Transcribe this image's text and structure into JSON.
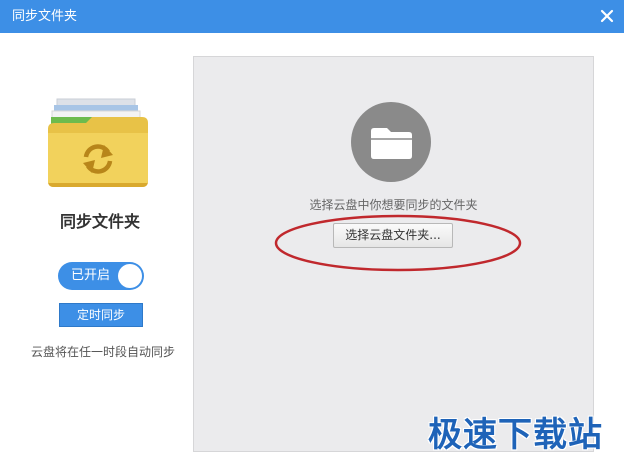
{
  "window": {
    "title": "同步文件夹",
    "accent_color": "#3d8fe6",
    "close_icon": "close-icon"
  },
  "sidebar": {
    "folder_icon": "sync-folder-icon",
    "heading": "同步文件夹",
    "toggle_label": "已开启",
    "toggle_on": true,
    "timer_button": "定时同步",
    "note": "云盘将在任一时段自动同步"
  },
  "main": {
    "folder_icon": "folder-icon",
    "prompt": "选择云盘中你想要同步的文件夹",
    "select_button": "选择云盘文件夹...",
    "annotation_color": "#c0282d"
  },
  "watermark": {
    "text": "极速下载站"
  }
}
